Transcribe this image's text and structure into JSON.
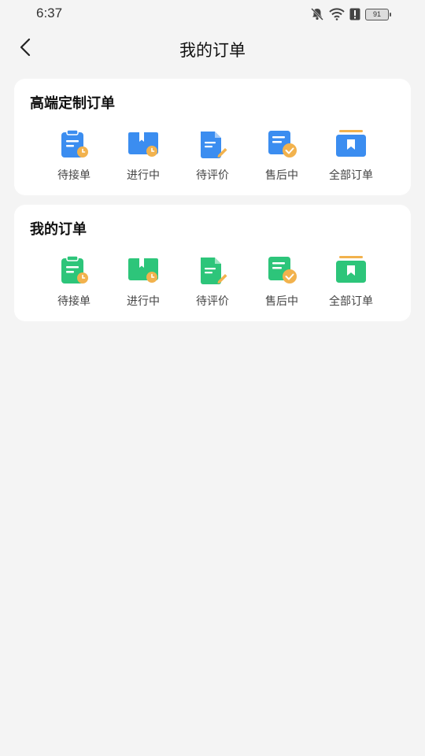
{
  "status_bar": {
    "time": "6:37",
    "battery": "91",
    "icons": [
      "bell-off-icon",
      "wifi-icon",
      "alert-icon",
      "battery-icon"
    ]
  },
  "nav": {
    "title": "我的订单",
    "back_icon": "chevron-left-icon"
  },
  "colors": {
    "blue_accent": "#3b8df0",
    "green_accent": "#2dc57a",
    "badge_orange": "#f2b24d"
  },
  "sections": [
    {
      "title": "高端定制订单",
      "items": [
        {
          "label": "待接单",
          "icon": "clipboard-clock-icon"
        },
        {
          "label": "进行中",
          "icon": "box-clock-icon"
        },
        {
          "label": "待评价",
          "icon": "document-pen-icon"
        },
        {
          "label": "售后中",
          "icon": "document-check-icon"
        },
        {
          "label": "全部订单",
          "icon": "box-bookmark-icon"
        }
      ]
    },
    {
      "title": "我的订单",
      "items": [
        {
          "label": "待接单",
          "icon": "clipboard-clock-icon"
        },
        {
          "label": "进行中",
          "icon": "box-clock-icon"
        },
        {
          "label": "待评价",
          "icon": "document-pen-icon"
        },
        {
          "label": "售后中",
          "icon": "document-check-icon"
        },
        {
          "label": "全部订单",
          "icon": "box-bookmark-icon"
        }
      ]
    }
  ]
}
